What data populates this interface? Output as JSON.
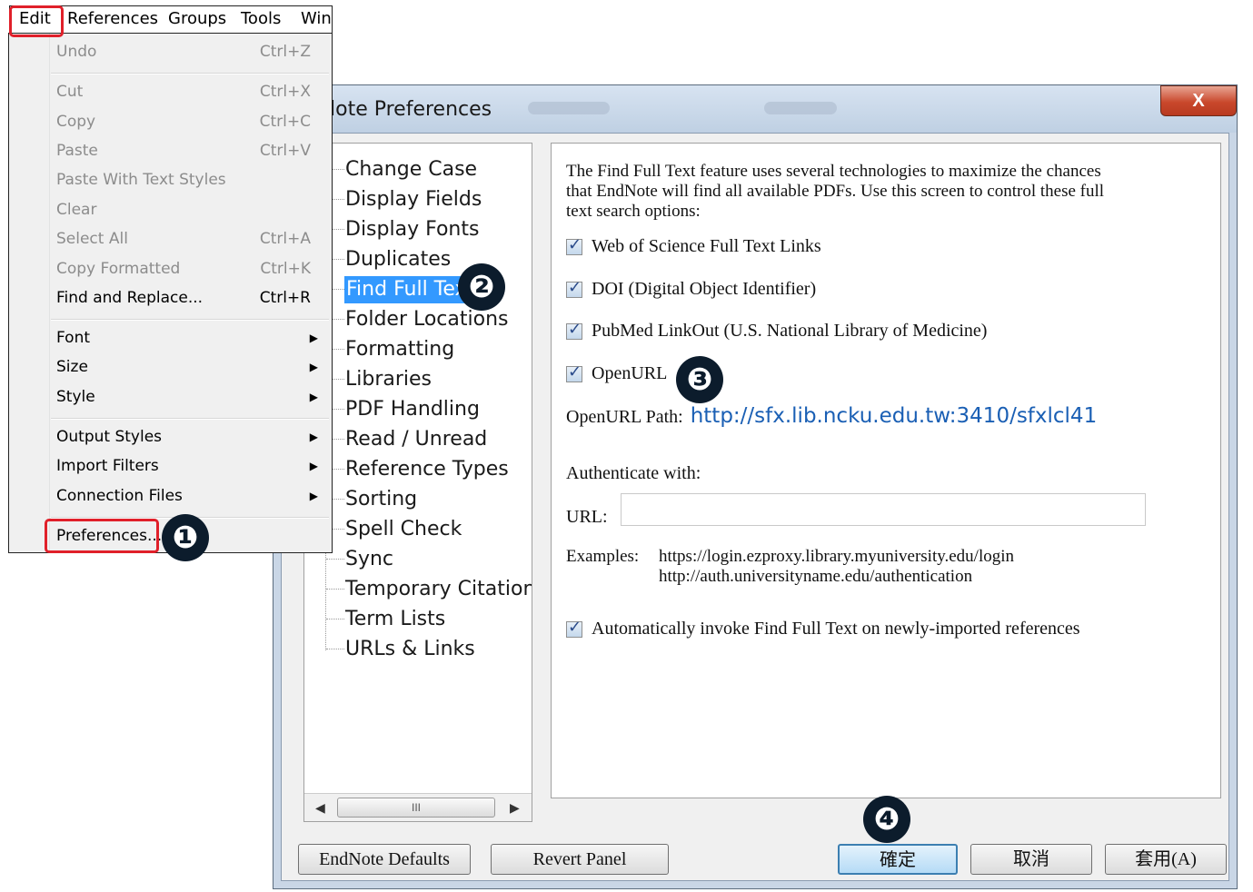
{
  "menubar": {
    "items": [
      "Edit",
      "References",
      "Groups",
      "Tools",
      "Win"
    ]
  },
  "edit_menu": {
    "undo": {
      "label": "Undo",
      "shortcut": "Ctrl+Z"
    },
    "cut": {
      "label": "Cut",
      "shortcut": "Ctrl+X"
    },
    "copy": {
      "label": "Copy",
      "shortcut": "Ctrl+C"
    },
    "paste": {
      "label": "Paste",
      "shortcut": "Ctrl+V"
    },
    "paste_styles": {
      "label": "Paste With Text Styles"
    },
    "clear": {
      "label": "Clear"
    },
    "select_all": {
      "label": "Select All",
      "shortcut": "Ctrl+A"
    },
    "copy_formatted": {
      "label": "Copy Formatted",
      "shortcut": "Ctrl+K"
    },
    "find_replace": {
      "label": "Find and Replace...",
      "shortcut": "Ctrl+R"
    },
    "font": {
      "label": "Font"
    },
    "size": {
      "label": "Size"
    },
    "style": {
      "label": "Style"
    },
    "output_styles": {
      "label": "Output Styles"
    },
    "import_filters": {
      "label": "Import Filters"
    },
    "connection_files": {
      "label": "Connection Files"
    },
    "preferences": {
      "label": "Preferences..."
    }
  },
  "dialog": {
    "title": "lote Preferences",
    "close": "X",
    "tree_items": [
      "Change Case",
      "Display Fields",
      "Display Fonts",
      "Duplicates",
      "Find Full Tex",
      "Folder Locations",
      "Formatting",
      "Libraries",
      "PDF Handling",
      "Read / Unread",
      "Reference Types",
      "Sorting",
      "Spell Check",
      "Sync",
      "Temporary Citations",
      "Term Lists",
      "URLs & Links"
    ],
    "scroll_thumb": "III",
    "description": "The Find Full Text feature uses several technologies to maximize the chances that EndNote will find all available PDFs. Use this screen to control these full text search options:",
    "options": {
      "wos": "Web of Science Full Text Links",
      "doi": "DOI (Digital Object Identifier)",
      "pubmed": "PubMed LinkOut (U.S. National Library of Medicine)",
      "openurl": "OpenURL",
      "auto": "Automatically invoke Find Full Text on newly-imported references"
    },
    "openurl_path_label": "OpenURL Path:",
    "openurl_path_value": "http://sfx.lib.ncku.edu.tw:3410/sfxlcl41",
    "authenticate_label": "Authenticate with:",
    "url_label": "URL:",
    "url_value": "",
    "examples_label": "Examples:",
    "examples": [
      "https://login.ezproxy.library.myuniversity.edu/login",
      "http://auth.universityname.edu/authentication"
    ],
    "buttons": {
      "defaults": "EndNote Defaults",
      "revert": "Revert Panel",
      "ok": "確定",
      "cancel": "取消",
      "apply": "套用(A)"
    }
  },
  "callouts": [
    "❶",
    "❷",
    "❸",
    "❹"
  ],
  "colors": {
    "highlight": "#3399ff",
    "callout_red": "#e0202a",
    "link_blue": "#1a5fb4"
  }
}
